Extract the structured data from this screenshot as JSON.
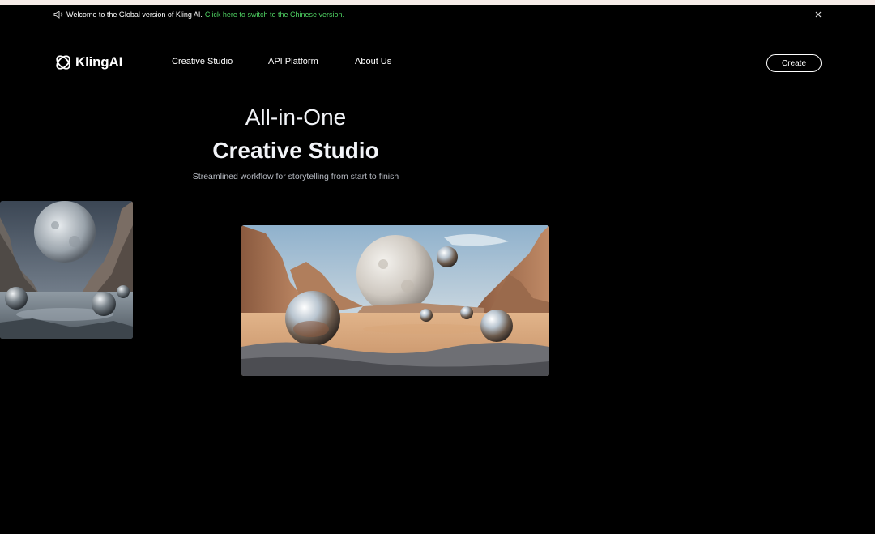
{
  "banner": {
    "icon": "megaphone-icon",
    "text": "Welcome to the Global version of Kling AI.",
    "link_text": "Click here to switch to the Chinese version.",
    "link_color": "#4ed162",
    "close_icon": "close-icon"
  },
  "header": {
    "logo_text": "KlingAI",
    "nav": [
      "Creative Studio",
      "API Platform",
      "About Us"
    ],
    "create_label": "Create"
  },
  "hero": {
    "title_line1": "All-in-One",
    "title_line2": "Creative Studio",
    "subtitle": "Streamlined workflow for storytelling from start to finish"
  },
  "gallery": {
    "cards": [
      "moonlit rocky canyon with metallic spheres",
      "desert canyon with giant moon and chrome spheres"
    ]
  },
  "colors": {
    "background": "#000000",
    "accent_link": "#4ed162",
    "top_strip": "#f6ece8"
  }
}
